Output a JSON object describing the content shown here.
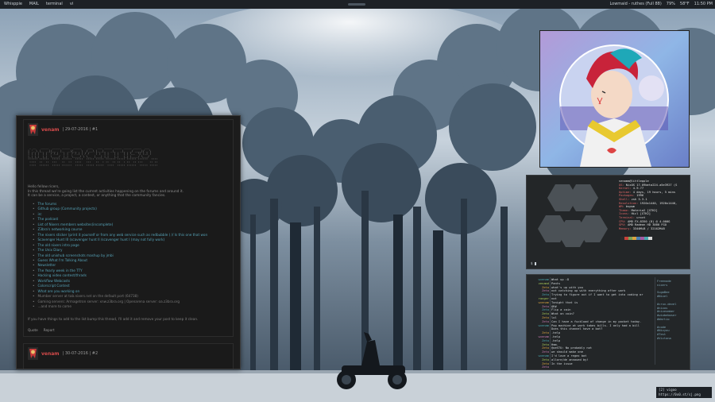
{
  "panel": {
    "left_items": [
      "Whisppie",
      "MAIL",
      "terminal",
      "vi"
    ],
    "right_items": [
      "Lowmaid - ruthes (Full 88)",
      "79%",
      "58°F",
      "11:50 PM"
    ]
  },
  "forum": {
    "post1": {
      "user": "venam",
      "meta": "| 29-07-2016 | #1",
      "greeting": "Hello fellow ricers,",
      "intro1": "In this thread we're going list the current activities happening on the forums and around it.",
      "intro2": "It can be a service, a project, a contest, or anything that the community fancies.",
      "items": [
        "The forums",
        "Github group (Community projects)",
        "irc",
        "The podcast",
        "List of Nixers members websites(incomplete)",
        "Z3bra's networking course",
        "The nixers sticker (print it yourself or from any web service such as redbubble ) // Is this one that won",
        "Scavenger Hunt III (scavenger hunt II /scavenger hunt I (may not fully work)",
        "The old nixers intro page",
        "The Unix Diary",
        "The old unixhub screenshots mashup by jmbi",
        "Guess What I'm Talking About",
        "Newsletter",
        "The Yearly week in the TTY",
        "Hacking video contest/thrads",
        "Workflow Webcasts",
        "Colorscript Contest",
        "What are you working on",
        "Mumber server at tab.nixers.net on the default port (64738)",
        "Gaming servers: Armagetron server: xnw.z3bra.org | Openarena server: oa.z3bra.org",
        "...and more to come"
      ],
      "footer": "If you have things to add to the list bump this thread, I'll add it and remove your post to keep it clean.",
      "quote_label": "Quote",
      "report_label": "Report"
    },
    "post2": {
      "user": "venam",
      "meta": "| 30-07-2016 | #2"
    }
  },
  "fetch": {
    "user_host": "venamm@littlepple",
    "rows": [
      {
        "k": "OS:",
        "v": "NixOS 17.09beta224.a5e3927 (S"
      },
      {
        "k": "Kernel:",
        "v": "4.9.77"
      },
      {
        "k": "Uptime:",
        "v": "4 days, 19 hours, 5 mins"
      },
      {
        "k": "Packages:",
        "v": "1996"
      },
      {
        "k": "Shell:",
        "v": "zsh 5.3.1"
      },
      {
        "k": "Resolution:",
        "v": "1920x1440, 1920x1440,"
      },
      {
        "k": "WM:",
        "v": "bspwm"
      },
      {
        "k": "Theme:",
        "v": "Materia2 [GTK2]"
      },
      {
        "k": "Icons:",
        "v": "Hicl [GTK2]"
      },
      {
        "k": "Terminal:",
        "v": "urxvt"
      },
      {
        "k": "CPU:",
        "v": "AMD FX-8350 (8) @ 4.000G"
      },
      {
        "k": "GPU:",
        "v": "AMD Radeon HD 3000 FGO"
      },
      {
        "k": "Memory:",
        "v": "3346MiB / 32162MiB"
      }
    ],
    "prompt": "$"
  },
  "irc": {
    "nicks": [
      "wvenam",
      "venamd",
      "Zeta",
      "Zeta",
      "Zeta",
      "ranger",
      "wvenam",
      "Zeta",
      "Zeta",
      "Zeta",
      "Zeta",
      "Zeta",
      "wvenam",
      "",
      "Zeta",
      "wvenam",
      "Zeta",
      "Zeta",
      "Zeta",
      "Zeta",
      "wvenam",
      "Zeta",
      "Zeta",
      "Zeta"
    ],
    "messages": [
      "What up :D",
      "Pants",
      "what's up with you",
      "not catching up with everything after work",
      "Trying to figure out if I want to get into coding or",
      "not",
      "Tonight that is",
      "@R#",
      "Flip a coin",
      "What on coin?",
      "lol",
      "Can I have a fuckload of change in my pocket today.",
      "Pop machine at work takes bills. I only had a bill",
      "Does this channel have a bot?",
      ".help",
      ".help",
      ".help",
      "Hmm.",
      "@oeSTU: No probably not",
      "we should make one",
      "I'd love a regex bot",
      "allore/de annoued by!",
      "In the issue",
      ""
    ],
    "users": [
      "Freenode",
      "nixers",
      "",
      "SugaBee",
      "#Nixel",
      "",
      "#crux-devel",
      "#nixos",
      "#nixexmber",
      "#wiobeboser",
      "#Wartio",
      "",
      "#code",
      "#Nixyou",
      "#Test",
      "#Victana"
    ]
  },
  "notification": {
    "text": "[2] vigoo",
    "sub": "https://0x0.st/sj.png"
  }
}
